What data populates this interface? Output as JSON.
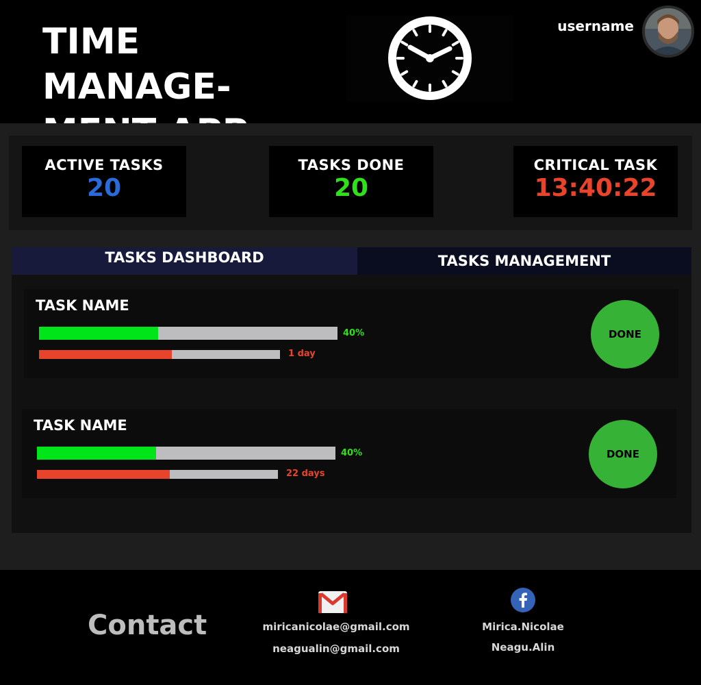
{
  "header": {
    "app_title_line1": "TIME MANAGE-",
    "app_title_line2": "MENT APP",
    "clock_icon": "clock-icon",
    "username": "username",
    "avatar_icon": "user-avatar"
  },
  "stats": [
    {
      "label": "ACTIVE TASKS",
      "value": "20",
      "color": "#2a6bd8"
    },
    {
      "label": "TASKS DONE",
      "value": "20",
      "color": "#2fe01a"
    },
    {
      "label": "CRITICAL TASK",
      "value": "13:40:22",
      "color": "#e8442b"
    }
  ],
  "tabs": [
    {
      "label": "TASKS DASHBOARD",
      "active": true
    },
    {
      "label": "TASKS MANAGEMENT",
      "active": false
    }
  ],
  "tasks": [
    {
      "name": "TASK NAME",
      "progress_percent": 40,
      "progress_label": "40%",
      "time_fraction": 0.55,
      "time_label": "1 day",
      "done_label": "DONE"
    },
    {
      "name": "TASK NAME",
      "progress_percent": 40,
      "progress_label": "40%",
      "time_fraction": 0.55,
      "time_label": "22 days",
      "done_label": "DONE"
    }
  ],
  "footer": {
    "contact_title": "Contact",
    "emails": [
      "miricanicolae@gmail.com",
      "neagualin@gmail.com"
    ],
    "facebook": [
      "Mirica.Nicolae",
      "Neagu.Alin"
    ],
    "gmail_icon": "gmail-icon",
    "facebook_icon": "facebook-icon"
  },
  "colors": {
    "accent_blue": "#2a6bd8",
    "accent_green": "#2fe01a",
    "accent_red": "#e8442b",
    "done_button": "#36b236"
  }
}
